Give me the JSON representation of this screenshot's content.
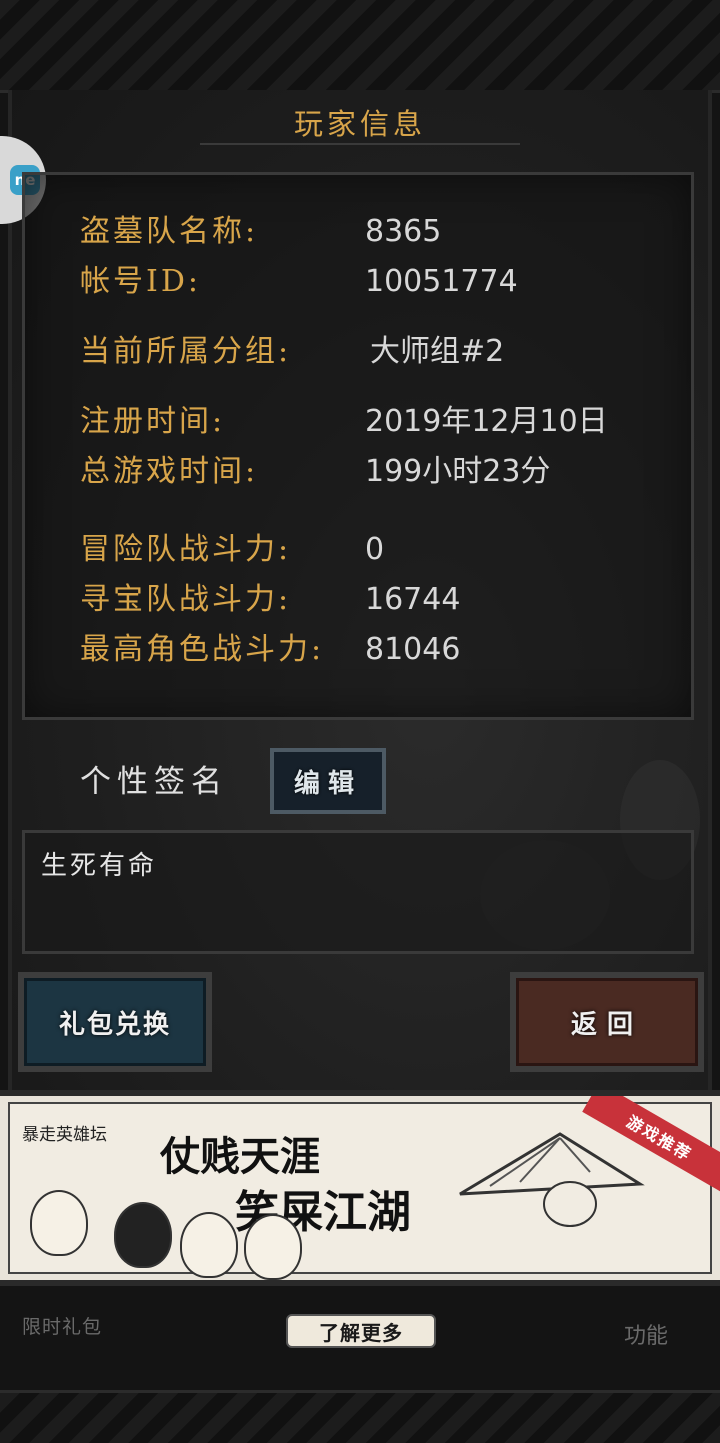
{
  "title": "玩家信息",
  "rows": [
    {
      "label": "盗墓队名称:",
      "value": "8365"
    },
    {
      "label": "帐号ID:",
      "value": "10051774"
    },
    {
      "label": "当前所属分组:",
      "value": "大师组#2"
    },
    {
      "label": "注册时间:",
      "value": "2019年12月10日"
    },
    {
      "label": "总游戏时间:",
      "value": "199小时23分"
    },
    {
      "label": "冒险队战斗力:",
      "value": "0"
    },
    {
      "label": "寻宝队战斗力:",
      "value": "16744"
    },
    {
      "label": "最高角色战斗力:",
      "value": "81046"
    }
  ],
  "signature": {
    "label": "个性签名",
    "edit_button": "编辑",
    "text": "生死有命"
  },
  "buttons": {
    "gift_exchange": "礼包兑换",
    "back": "返回"
  },
  "ad": {
    "forum": "暴走英雄坛",
    "line1": "仗贱天涯",
    "line2": "笑屎江湖",
    "tag": "游戏推荐",
    "learn_more": "了解更多"
  },
  "bottom_nav": {
    "limited_gift": "限时礼包",
    "function": "功能"
  },
  "side_badge": "ne"
}
